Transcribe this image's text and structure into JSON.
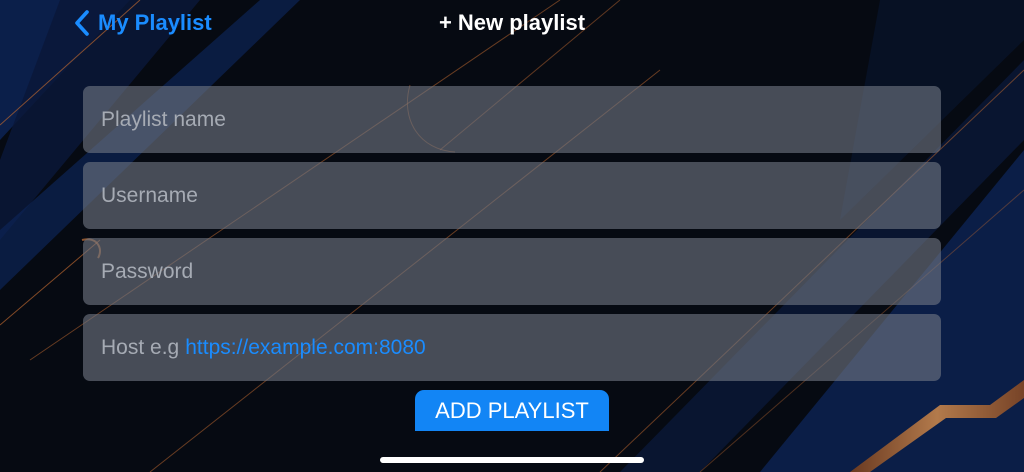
{
  "nav": {
    "back_label": "My Playlist",
    "title": "+ New playlist"
  },
  "form": {
    "playlist_name_placeholder": "Playlist name",
    "username_placeholder": "Username",
    "password_placeholder": "Password",
    "host_placeholder_prefix": "Host e.g",
    "host_placeholder_example": "https://example.com:8080"
  },
  "add_button_label": "ADD PLAYLIST",
  "colors": {
    "accent": "#1a8cff",
    "button": "#1285f5",
    "field_bg": "#6f7682",
    "placeholder": "#a6abb4",
    "copper_line": "#c8743a"
  },
  "icons": {
    "back": "chevron-left-icon"
  }
}
